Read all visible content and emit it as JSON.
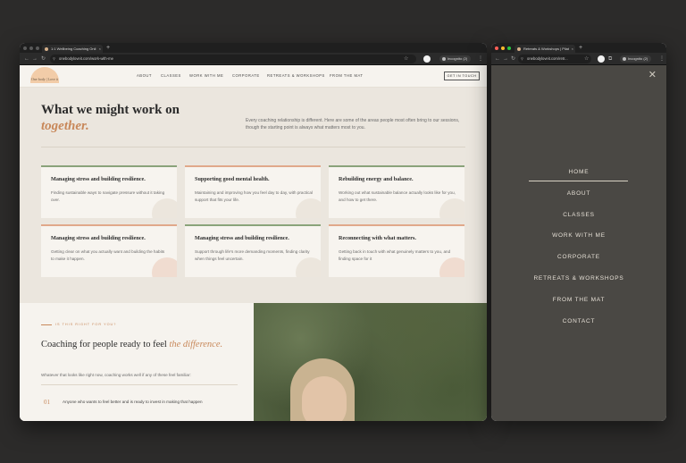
{
  "left_browser": {
    "tab_title": "1:1 Wellbeing Coaching Onli",
    "url": "onebodyloveit.com/work-with-me",
    "incognito_label": "Incognito (2)"
  },
  "right_browser": {
    "tab_title": "Retreats & Workshops | Pilat",
    "url": "onebodyloveit.com/retr...",
    "incognito_label": "Incognito (2)"
  },
  "site": {
    "logo_text": "One body | Love it",
    "nav": [
      "ABOUT",
      "CLASSES",
      "WORK WITH ME",
      "CORPORATE",
      "RETREATS & WORKSHOPS",
      "FROM THE MAT"
    ],
    "cta": "GET IN TOUCH"
  },
  "hero": {
    "title_line1": "What we might work on",
    "title_line2": "together.",
    "intro": "Every coaching relationship is different. Here are some of the areas people most often bring to our sessions, though the starting point is always what matters most to you."
  },
  "cards": [
    {
      "title": "Managing stress and building resilience.",
      "body": "Finding sustainable ways to navigate pressure without it taking over.",
      "accent": "#8aa37a"
    },
    {
      "title": "Supporting good mental health.",
      "body": "Maintaining and improving how you feel day to day, with practical support that fits your life.",
      "accent": "#e0a88a"
    },
    {
      "title": "Rebuilding energy and balance.",
      "body": "Working out what sustainable balance actually looks like for you, and how to get there.",
      "accent": "#8aa37a"
    },
    {
      "title": "Managing stress and building resilience.",
      "body": "Getting clear on what you actually want and building the habits to make it happen.",
      "accent": "#e0a88a"
    },
    {
      "title": "Managing stress and building resilience.",
      "body": "Support through life's more demanding moments, finding clarity when things feel uncertain.",
      "accent": "#8aa37a"
    },
    {
      "title": "Reconnecting with what matters.",
      "body": "Getting back in touch with what genuinely matters to you, and finding space for it",
      "accent": "#e0a88a"
    }
  ],
  "section2": {
    "eyebrow": "IS THIS RIGHT FOR YOU?",
    "title_plain": "Coaching for people ready to feel ",
    "title_em": "the difference.",
    "desc": "Whatever that looks like right now, coaching works well if any of these feel familiar:",
    "item_num": "01",
    "item_text": "Anyone who wants to feel better and is ready to invest in making that happen"
  },
  "mobile_menu": {
    "items": [
      "HOME",
      "ABOUT",
      "CLASSES",
      "WORK WITH ME",
      "CORPORATE",
      "RETREATS & WORKSHOPS",
      "FROM THE MAT",
      "CONTACT"
    ]
  }
}
